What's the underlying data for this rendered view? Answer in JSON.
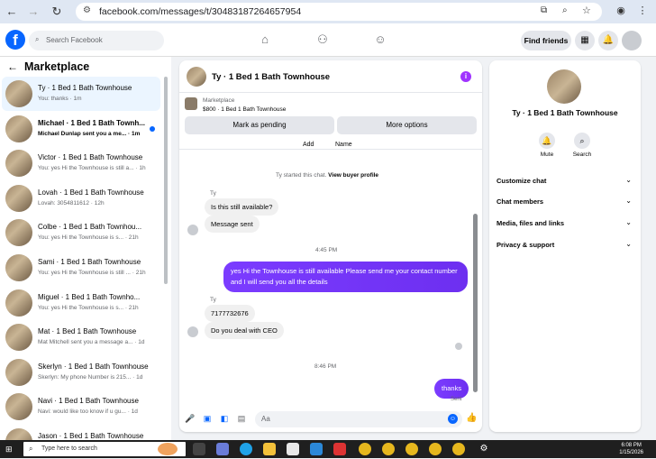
{
  "browser": {
    "url": "facebook.com/messages/t/30483187264657954"
  },
  "header": {
    "search_placeholder": "Search Facebook",
    "find_friends": "Find friends"
  },
  "left": {
    "title": "Marketplace",
    "conversations": [
      {
        "name": "Ty · 1 Bed 1 Bath Townhouse",
        "preview": "You: thanks · 1m",
        "active": true
      },
      {
        "name": "Michael · 1 Bed 1 Bath Townh...",
        "preview": "Michael Dunlap sent you a me... · 1m",
        "unread": true
      },
      {
        "name": "Victor · 1 Bed 1 Bath Townhouse",
        "preview": "You: yes Hi the Townhouse is still a... · 1h"
      },
      {
        "name": "Lovah · 1 Bed 1 Bath Townhouse",
        "preview": "Lovah: 3054811612 · 12h"
      },
      {
        "name": "Colbe · 1 Bed 1 Bath Townhou...",
        "preview": "You: yes Hi the Townhouse is s... · 21h"
      },
      {
        "name": "Sami · 1 Bed 1 Bath Townhouse",
        "preview": "You: yes Hi the Townhouse is still ... · 21h"
      },
      {
        "name": "Miguel · 1 Bed 1 Bath Townho...",
        "preview": "You: yes Hi the Townhouse is s... · 21h"
      },
      {
        "name": "Mat · 1 Bed 1 Bath Townhouse",
        "preview": "Mat Mitchell sent you a message a... · 1d"
      },
      {
        "name": "Skerlyn · 1 Bed 1 Bath Townhouse",
        "preview": "Skerlyn: My phone Number is 215... · 1d"
      },
      {
        "name": "Navi · 1 Bed 1 Bath Townhouse",
        "preview": "Navi: would like too know if u gu... · 1d"
      },
      {
        "name": "Jason · 1 Bed 1 Bath Townhouse",
        "preview": ""
      }
    ]
  },
  "chat": {
    "title": "Ty · 1 Bed 1 Bath Townhouse",
    "listing_label": "Marketplace",
    "listing_value": "$800 · 1 Bed 1 Bath Townhouse",
    "mark_pending": "Mark as pending",
    "more_options": "More options",
    "add": "Add",
    "name": "Name",
    "started": "Ty started this chat.",
    "view_profile": "View buyer profile",
    "sender1": "Ty",
    "msg1": "Is this still available?",
    "msg2": "Message sent",
    "time1": "4:45 PM",
    "out1": "yes Hi the Townhouse is still available Please send me your contact number and I will send you all the details",
    "sender2": "Ty",
    "msg3": "7177732676",
    "msg4": "Do you deal with CEO",
    "time2": "8:46 PM",
    "out2": "thanks",
    "sent": "Sent",
    "input_placeholder": "Aa"
  },
  "right": {
    "title": "Ty · 1 Bed 1 Bath Townhouse",
    "mute": "Mute",
    "search": "Search",
    "rows": [
      "Customize chat",
      "Chat members",
      "Media, files and links",
      "Privacy & support"
    ]
  },
  "taskbar": {
    "search_placeholder": "Type here to search",
    "time": "6:08 PM",
    "date": "1/15/2026"
  }
}
